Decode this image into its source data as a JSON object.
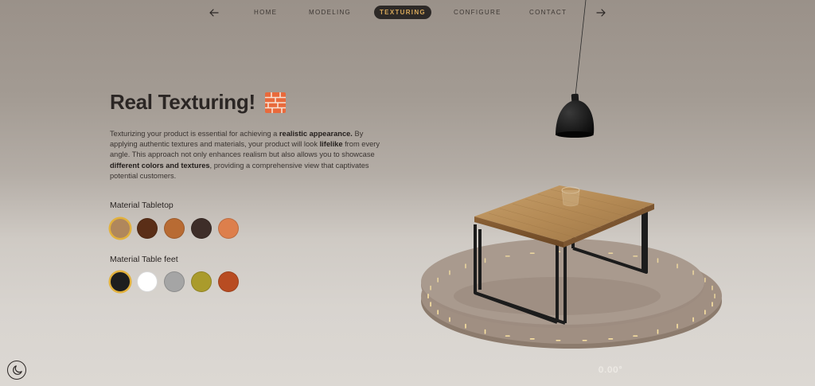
{
  "nav": {
    "items": [
      {
        "label": "HOME",
        "active": false
      },
      {
        "label": "MODELING",
        "active": false
      },
      {
        "label": "TEXTURING",
        "active": true
      },
      {
        "label": "CONFIGURE",
        "active": false
      },
      {
        "label": "CONTACT",
        "active": false
      }
    ],
    "prev_icon": "arrow-left-icon",
    "next_icon": "arrow-right-icon"
  },
  "hero": {
    "title": "Real Texturing!",
    "title_icon": "brick-icon",
    "description_parts": [
      {
        "text": "Texturizing your product is essential for achieving a ",
        "bold": false
      },
      {
        "text": "realistic appearance.",
        "bold": true
      },
      {
        "text": " By applying authentic textures and materials, your product will look ",
        "bold": false
      },
      {
        "text": "lifelike",
        "bold": true
      },
      {
        "text": " from every angle. This approach not only enhances realism but also allows you to showcase ",
        "bold": false
      },
      {
        "text": "different colors and textures",
        "bold": true
      },
      {
        "text": ", providing a comprehensive view that captivates potential customers.",
        "bold": false
      }
    ]
  },
  "materials": {
    "tabletop": {
      "label": "Material Tabletop",
      "options": [
        {
          "color": "#b0875c",
          "selected": true
        },
        {
          "color": "#5a2e17",
          "selected": false
        },
        {
          "color": "#b86b33",
          "selected": false
        },
        {
          "color": "#3e2e29",
          "selected": false
        },
        {
          "color": "#dd7f4c",
          "selected": false
        }
      ]
    },
    "feet": {
      "label": "Material Table feet",
      "options": [
        {
          "color": "#1e1e1e",
          "selected": true
        },
        {
          "color": "#ffffff",
          "selected": false
        },
        {
          "color": "#a5a5a5",
          "selected": false
        },
        {
          "color": "#aa9b2c",
          "selected": false
        },
        {
          "color": "#b84c22",
          "selected": false
        }
      ]
    }
  },
  "viewer": {
    "rotation_readout": "0.00°"
  },
  "theme_toggle": {
    "icon": "moon-icon"
  },
  "colors": {
    "accent": "#e2b13c",
    "active_nav_bg": "#2d2927",
    "active_nav_text": "#d8a85a"
  }
}
